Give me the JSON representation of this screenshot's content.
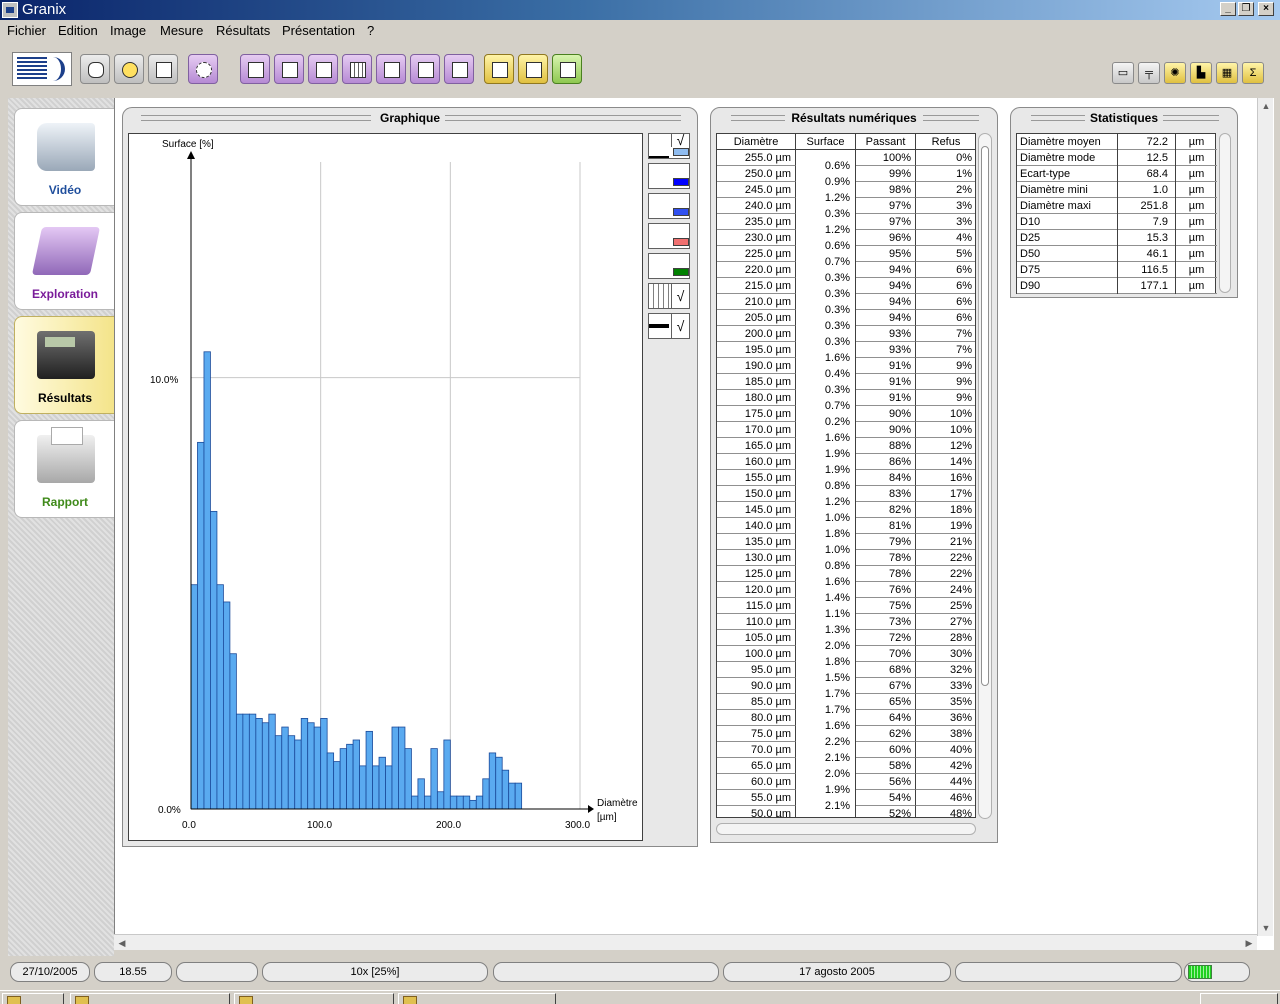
{
  "window": {
    "title": "Granix"
  },
  "menu": [
    "Fichier",
    "Edition",
    "Image",
    "Mesure",
    "Résultats",
    "Présentation",
    "?"
  ],
  "sidebar": {
    "items": [
      {
        "label": "Vidéo",
        "color": "#1f4e9c"
      },
      {
        "label": "Exploration",
        "color": "#7a1c9a"
      },
      {
        "label": "Résultats",
        "color": "#000000"
      },
      {
        "label": "Rapport",
        "color": "#3f8a1a"
      }
    ]
  },
  "graph": {
    "title": "Graphique",
    "ylabel": "Surface [%]",
    "xlabel_line1": "Diamètre",
    "xlabel_line2": "[µm]",
    "yticks": [
      "10.0%",
      "0.0%"
    ],
    "xticks": [
      "0.0",
      "100.0",
      "200.0",
      "300.0"
    ],
    "check": "√",
    "swatches": [
      "#8fbcf0",
      "#0000ff",
      "#3050f0",
      "#f07070",
      "#008000"
    ]
  },
  "chart_data": {
    "type": "bar",
    "title": "",
    "xlabel": "Diamètre [µm]",
    "ylabel": "Surface [%]",
    "xlim": [
      0,
      300
    ],
    "ylim": [
      0,
      15
    ],
    "bin_width": 5,
    "x": [
      2.5,
      7.5,
      12.5,
      17.5,
      22.5,
      27.5,
      32.5,
      37.5,
      42.5,
      47.5,
      52.5,
      57.5,
      62.5,
      67.5,
      72.5,
      77.5,
      82.5,
      87.5,
      92.5,
      97.5,
      102.5,
      107.5,
      112.5,
      117.5,
      122.5,
      127.5,
      132.5,
      137.5,
      142.5,
      147.5,
      152.5,
      157.5,
      162.5,
      167.5,
      172.5,
      177.5,
      182.5,
      187.5,
      192.5,
      197.5,
      202.5,
      207.5,
      212.5,
      217.5,
      222.5,
      227.5,
      232.5,
      237.5,
      242.5,
      247.5,
      252.5
    ],
    "values": [
      5.2,
      8.5,
      10.6,
      6.9,
      5.2,
      4.8,
      3.6,
      2.2,
      2.2,
      2.2,
      2.1,
      2.0,
      2.2,
      1.7,
      1.9,
      1.7,
      1.6,
      2.1,
      2.0,
      1.9,
      2.1,
      1.3,
      1.1,
      1.4,
      1.5,
      1.6,
      1.0,
      1.8,
      1.0,
      1.2,
      1.0,
      1.9,
      1.9,
      1.4,
      0.3,
      0.7,
      0.3,
      1.4,
      0.4,
      1.6,
      0.3,
      0.3,
      0.3,
      0.2,
      0.3,
      0.7,
      1.3,
      1.2,
      0.9,
      0.6,
      0.6
    ],
    "grid": true,
    "color": "#5aaaf0"
  },
  "results": {
    "title": "Résultats numériques",
    "headers": [
      "Diamètre",
      "Surface",
      "Passant",
      "Refus"
    ],
    "rows": [
      [
        "255.0 µm",
        "100%",
        "0%"
      ],
      [
        "250.0 µm",
        "99%",
        "1%"
      ],
      [
        "245.0 µm",
        "98%",
        "2%"
      ],
      [
        "240.0 µm",
        "97%",
        "3%"
      ],
      [
        "235.0 µm",
        "97%",
        "3%"
      ],
      [
        "230.0 µm",
        "96%",
        "4%"
      ],
      [
        "225.0 µm",
        "95%",
        "5%"
      ],
      [
        "220.0 µm",
        "94%",
        "6%"
      ],
      [
        "215.0 µm",
        "94%",
        "6%"
      ],
      [
        "210.0 µm",
        "94%",
        "6%"
      ],
      [
        "205.0 µm",
        "94%",
        "6%"
      ],
      [
        "200.0 µm",
        "93%",
        "7%"
      ],
      [
        "195.0 µm",
        "93%",
        "7%"
      ],
      [
        "190.0 µm",
        "91%",
        "9%"
      ],
      [
        "185.0 µm",
        "91%",
        "9%"
      ],
      [
        "180.0 µm",
        "91%",
        "9%"
      ],
      [
        "175.0 µm",
        "90%",
        "10%"
      ],
      [
        "170.0 µm",
        "90%",
        "10%"
      ],
      [
        "165.0 µm",
        "88%",
        "12%"
      ],
      [
        "160.0 µm",
        "86%",
        "14%"
      ],
      [
        "155.0 µm",
        "84%",
        "16%"
      ],
      [
        "150.0 µm",
        "83%",
        "17%"
      ],
      [
        "145.0 µm",
        "82%",
        "18%"
      ],
      [
        "140.0 µm",
        "81%",
        "19%"
      ],
      [
        "135.0 µm",
        "79%",
        "21%"
      ],
      [
        "130.0 µm",
        "78%",
        "22%"
      ],
      [
        "125.0 µm",
        "78%",
        "22%"
      ],
      [
        "120.0 µm",
        "76%",
        "24%"
      ],
      [
        "115.0 µm",
        "75%",
        "25%"
      ],
      [
        "110.0 µm",
        "73%",
        "27%"
      ],
      [
        "105.0 µm",
        "72%",
        "28%"
      ],
      [
        "100.0 µm",
        "70%",
        "30%"
      ],
      [
        "95.0 µm",
        "68%",
        "32%"
      ],
      [
        "90.0 µm",
        "67%",
        "33%"
      ],
      [
        "85.0 µm",
        "65%",
        "35%"
      ],
      [
        "80.0 µm",
        "64%",
        "36%"
      ],
      [
        "75.0 µm",
        "62%",
        "38%"
      ],
      [
        "70.0 µm",
        "60%",
        "40%"
      ],
      [
        "65.0 µm",
        "58%",
        "42%"
      ],
      [
        "60.0 µm",
        "56%",
        "44%"
      ],
      [
        "55.0 µm",
        "54%",
        "46%"
      ],
      [
        "50.0 µm",
        "52%",
        "48%"
      ]
    ],
    "surface": [
      "0.6%",
      "0.9%",
      "1.2%",
      "0.3%",
      "1.2%",
      "0.6%",
      "0.7%",
      "0.3%",
      "0.3%",
      "0.3%",
      "0.3%",
      "0.3%",
      "1.6%",
      "0.4%",
      "0.3%",
      "0.7%",
      "0.2%",
      "1.6%",
      "1.9%",
      "1.9%",
      "0.8%",
      "1.2%",
      "1.0%",
      "1.8%",
      "1.0%",
      "0.8%",
      "1.6%",
      "1.4%",
      "1.1%",
      "1.3%",
      "2.0%",
      "1.8%",
      "1.5%",
      "1.7%",
      "1.7%",
      "1.6%",
      "2.2%",
      "2.1%",
      "2.0%",
      "1.9%",
      "2.1%"
    ]
  },
  "stats": {
    "title": "Statistiques",
    "rows": [
      {
        "name": "Diamètre moyen",
        "value": "72.2",
        "unit": "µm"
      },
      {
        "name": "Diamètre mode",
        "value": "12.5",
        "unit": "µm"
      },
      {
        "name": "Ecart-type",
        "value": "68.4",
        "unit": "µm"
      },
      {
        "name": "Diamètre mini",
        "value": "1.0",
        "unit": "µm"
      },
      {
        "name": "Diamètre maxi",
        "value": "251.8",
        "unit": "µm"
      },
      {
        "name": "D10",
        "value": "7.9",
        "unit": "µm"
      },
      {
        "name": "D25",
        "value": "15.3",
        "unit": "µm"
      },
      {
        "name": "D50",
        "value": "46.1",
        "unit": "µm"
      },
      {
        "name": "D75",
        "value": "116.5",
        "unit": "µm"
      },
      {
        "name": "D90",
        "value": "177.1",
        "unit": "µm"
      }
    ]
  },
  "statusbar": {
    "date": "27/10/2005",
    "time": "18.55",
    "zoom": "10x [25%]",
    "date2": "17 agosto 2005"
  },
  "toolbar": {
    "sigma": "Σ"
  }
}
